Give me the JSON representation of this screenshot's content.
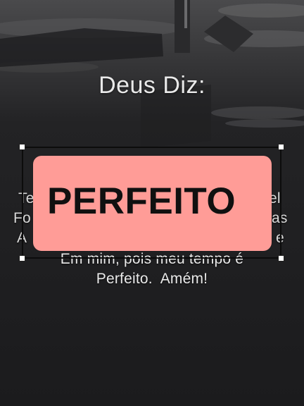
{
  "video": {
    "heading": "Deus Diz:",
    "caption_partial": {
      "line1_left": "Te",
      "line1_right": "el",
      "line2_left": "Fo",
      "line2_right": "as",
      "line3_left": "A",
      "line3_right": "e"
    },
    "caption_line4": "Em mim, pois meu tempo é",
    "caption_line5": "Perfeito.  Amém!"
  },
  "text_sticker": {
    "text": "PERFEITO",
    "background_color": "#ff9c97",
    "text_color": "#101010"
  },
  "selection": {
    "frame_color": "#0c0c0c",
    "handle_color": "#ffffff"
  },
  "background_color": "#1b1b1d"
}
